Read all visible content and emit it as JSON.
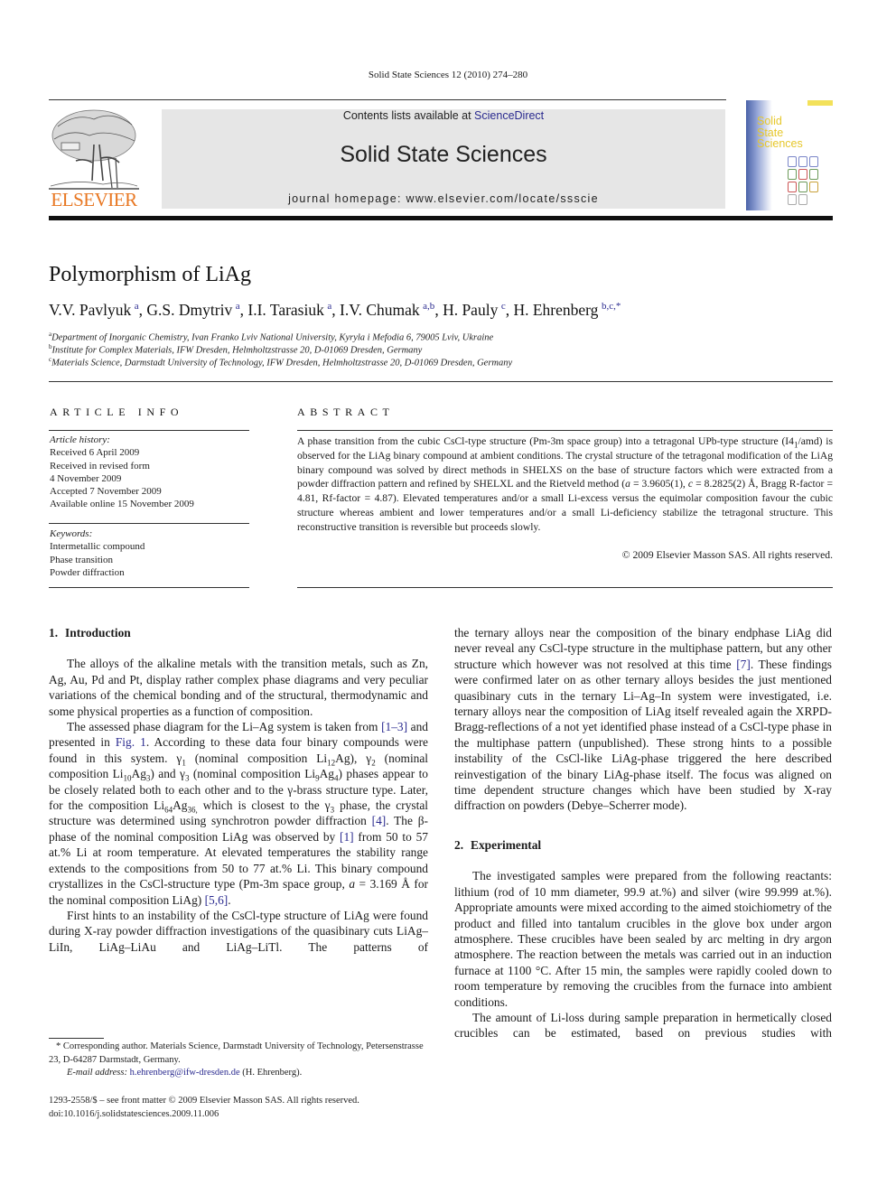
{
  "header": {
    "citation": "Solid State Sciences 12 (2010) 274–280",
    "contents_prefix": "Contents lists available at ",
    "contents_link": "ScienceDirect",
    "journal_title": "Solid State Sciences",
    "homepage": "journal homepage: www.elsevier.com/locate/ssscie",
    "publisher_logo": "ELSEVIER",
    "cover_title_lines": [
      "Solid",
      "State",
      "Sciences"
    ]
  },
  "article": {
    "title": "Polymorphism of LiAg",
    "authors": [
      {
        "name": "V.V. Pavlyuk",
        "aff": "a"
      },
      {
        "name": "G.S. Dmytriv",
        "aff": "a"
      },
      {
        "name": "I.I. Tarasiuk",
        "aff": "a"
      },
      {
        "name": "I.V. Chumak",
        "aff": "a,b"
      },
      {
        "name": "H. Pauly",
        "aff": "c"
      },
      {
        "name": "H. Ehrenberg",
        "aff": "b,c,*"
      }
    ],
    "affiliations": [
      {
        "key": "a",
        "text": "Department of Inorganic Chemistry, Ivan Franko Lviv National University, Kyryla i Mefodia 6, 79005 Lviv, Ukraine"
      },
      {
        "key": "b",
        "text": "Institute for Complex Materials, IFW Dresden, Helmholtzstrasse 20, D-01069 Dresden, Germany"
      },
      {
        "key": "c",
        "text": "Materials Science, Darmstadt University of Technology, IFW Dresden, Helmholtzstrasse 20, D-01069 Dresden, Germany"
      }
    ]
  },
  "article_info": {
    "heading": "ARTICLE INFO",
    "history_label": "Article history:",
    "history": [
      "Received 6 April 2009",
      "Received in revised form",
      "4 November 2009",
      "Accepted 7 November 2009",
      "Available online 15 November 2009"
    ],
    "keywords_label": "Keywords:",
    "keywords": [
      "Intermetallic compound",
      "Phase transition",
      "Powder diffraction"
    ]
  },
  "abstract": {
    "heading": "ABSTRACT",
    "p1": "A phase transition from the cubic CsCl-type structure (Pm-3m space group) into a tetragonal UPb-type structure (I4",
    "p1_sub": "1",
    "p2": "/amd) is observed for the LiAg binary compound at ambient conditions. The crystal structure of the tetragonal modification of the LiAg binary compound was solved by direct methods in SHELXS on the base of structure factors which were extracted from a powder diffraction pattern and refined by SHELXL and the Rietveld method (",
    "a_sym": "a",
    "p3": " = 3.9605(1), ",
    "c_sym": "c",
    "p4": " = 8.2825(2) Å, Bragg R-factor = 4.81, Rf-factor = 4.87). Elevated temperatures and/or a small Li-excess versus the equimolar composition favour the cubic structure whereas ambient and lower temperatures and/or a small Li-deficiency stabilize the tetragonal structure. This reconstructive transition is reversible but proceeds slowly.",
    "copyright": "© 2009 Elsevier Masson SAS. All rights reserved."
  },
  "sections": {
    "intro": {
      "number": "1.",
      "title": "Introduction",
      "para1": "The alloys of the alkaline metals with the transition metals, such as Zn, Ag, Au, Pd and Pt, display rather complex phase diagrams and very peculiar variations of the chemical bonding and of the structural, thermodynamic and some physical properties as a function of composition.",
      "para2": {
        "t1": "The assessed phase diagram for the Li–Ag system is taken from ",
        "ref1": "[1–3]",
        "t2": " and presented in ",
        "fig": "Fig. 1",
        "t3": ". According to these data four binary compounds were found in this system. γ",
        "s1": "1",
        "t4": " (nominal composition Li",
        "s2": "12",
        "t5": "Ag), γ",
        "s3": "2",
        "t6": " (nominal composition Li",
        "s4": "10",
        "t7": "Ag",
        "s5": "3",
        "t8": ") and γ",
        "s6": "3",
        "t9": " (nominal composition Li",
        "s7": "9",
        "t10": "Ag",
        "s8": "4",
        "t11": ") phases appear to be closely related both to each other and to the γ-brass structure type. Later, for the composition Li",
        "s9": "64",
        "t12": "Ag",
        "s10": "36,",
        "t13": " which is closest to the γ",
        "s11": "3",
        "t14": " phase, the crystal structure was determined using synchrotron powder diffraction ",
        "ref2": "[4]",
        "t15": ". The β-phase of the nominal composition LiAg was observed by ",
        "ref3": "[1]",
        "t16": " from 50 to 57 at.% Li at room temperature. At elevated temperatures the stability range extends to the compositions from 50 to 77 at.% Li. This binary compound crystallizes in the CsCl-structure type (Pm-3m space group, ",
        "a_sym": "a",
        "t17": " = 3.169 Å for the nominal composition LiAg) ",
        "ref4": "[5,6]",
        "t18": "."
      },
      "para3": "First hints to an instability of the CsCl-type structure of LiAg were found during X-ray powder diffraction investigations of the quasibinary cuts LiAg–LiIn, LiAg–LiAu and LiAg–LiTl. The patterns of",
      "para3_cont": {
        "t1": "the ternary alloys near the composition of the binary endphase LiAg did never reveal any CsCl-type structure in the multiphase pattern, but any other structure which however was not resolved at this time ",
        "ref": "[7]",
        "t2": ". These findings were confirmed later on as other ternary alloys besides the just mentioned quasibinary cuts in the ternary Li–Ag–In system were investigated, i.e. ternary alloys near the composition of LiAg itself revealed again the XRPD-Bragg-reflections of a not yet identified phase instead of a CsCl-type phase in the multiphase pattern (unpublished). These strong hints to a possible instability of the CsCl-like LiAg-phase triggered the here described reinvestigation of the binary LiAg-phase itself. The focus was aligned on time dependent structure changes which have been studied by X-ray diffraction on powders (Debye–Scherrer mode)."
      }
    },
    "experimental": {
      "number": "2.",
      "title": "Experimental",
      "para1": "The investigated samples were prepared from the following reactants: lithium (rod of 10 mm diameter, 99.9 at.%) and silver (wire 99.999 at.%). Appropriate amounts were mixed according to the aimed stoichiometry of the product and filled into tantalum crucibles in the glove box under argon atmosphere. These crucibles have been sealed by arc melting in dry argon atmosphere. The reaction between the metals was carried out in an induction furnace at 1100 °C. After 15 min, the samples were rapidly cooled down to room temperature by removing the crucibles from the furnace into ambient conditions.",
      "para2": "The amount of Li-loss during sample preparation in hermetically closed crucibles can be estimated, based on previous studies with"
    }
  },
  "footnote": {
    "corresponding": "* Corresponding author. Materials Science, Darmstadt University of Technology, Petersenstrasse 23, D-64287 Darmstadt, Germany.",
    "email_label": "E-mail address: ",
    "email": "h.ehrenberg@ifw-dresden.de",
    "email_suffix": " (H. Ehrenberg).",
    "front_matter": "1293-2558/$ – see front matter © 2009 Elsevier Masson SAS. All rights reserved.",
    "doi": "doi:10.1016/j.solidstatesciences.2009.11.006"
  }
}
